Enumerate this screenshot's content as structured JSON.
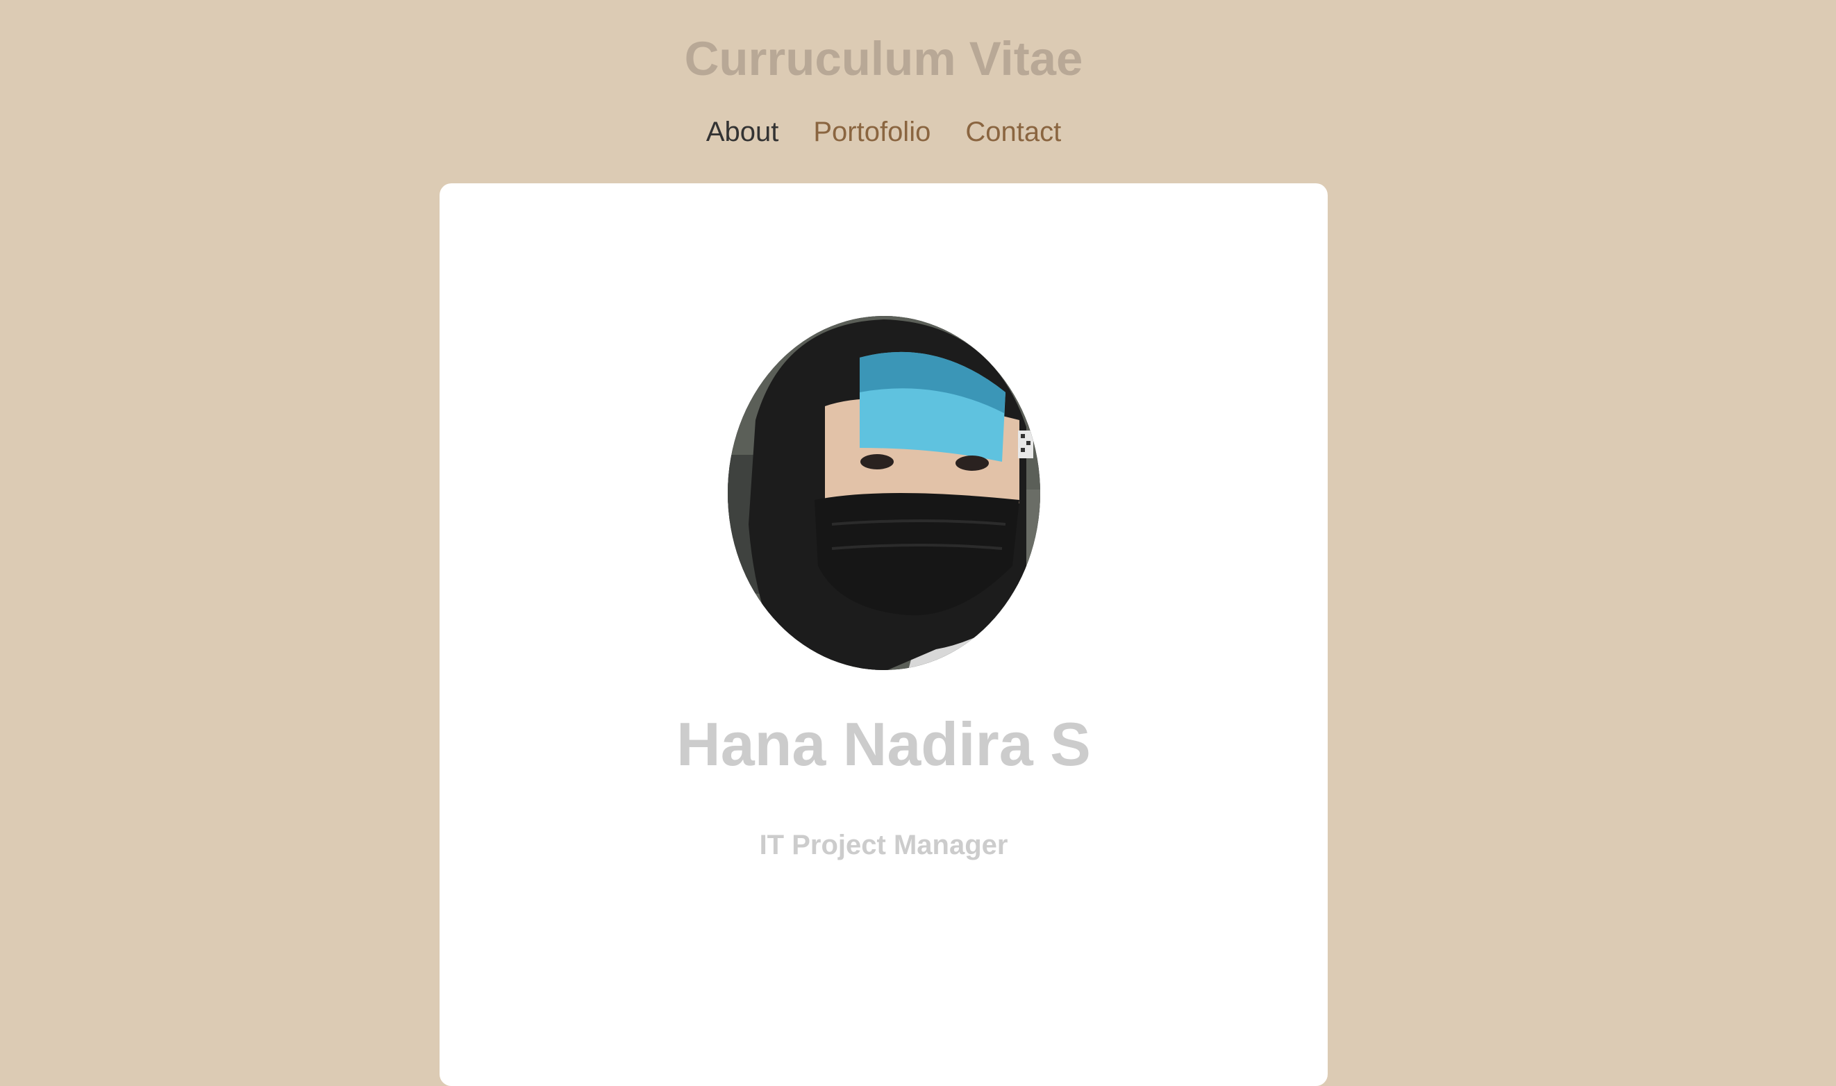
{
  "header": {
    "title": "Curruculum Vitae"
  },
  "nav": {
    "items": [
      {
        "label": "About",
        "active": true
      },
      {
        "label": "Portofolio",
        "active": false
      },
      {
        "label": "Contact",
        "active": false
      }
    ]
  },
  "profile": {
    "name": "Hana Nadira S",
    "role": "IT Project Manager"
  },
  "colors": {
    "page_background": "#dccbb4",
    "title": "#b8a896",
    "nav_link": "#8a6540",
    "nav_active": "#333333",
    "card_background": "#ffffff",
    "name_text": "#cccccc"
  }
}
